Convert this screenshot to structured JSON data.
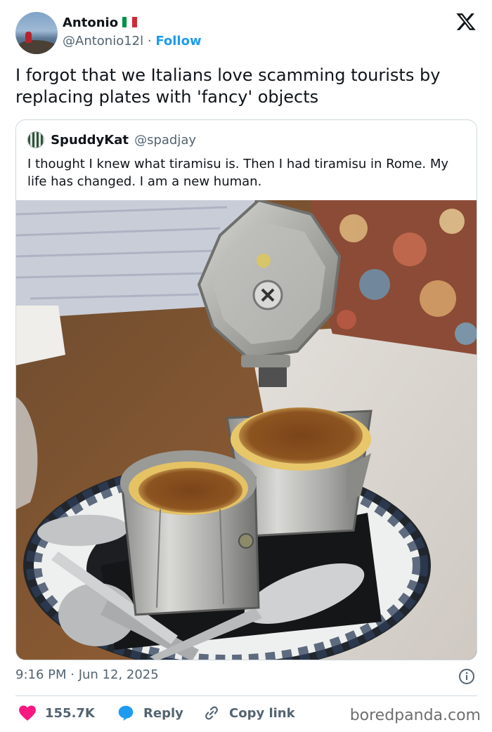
{
  "author": {
    "name": "Antonio",
    "handle": "@Antonio12l",
    "separator": "·",
    "follow_label": "Follow",
    "flag_colors": [
      "#009246",
      "#ffffff",
      "#ce2b37"
    ]
  },
  "tweet": {
    "text": "I forgot that we Italians love scamming tourists by replacing plates with 'fancy' objects",
    "timestamp": "9:16 PM · Jun 12, 2025"
  },
  "quoted": {
    "name": "SpuddyKat",
    "handle": "@spadjay",
    "text": "I thought I knew what tiramisu is. Then I had tiramisu in Rome. My life has changed. I am a new human."
  },
  "actions": {
    "like_count": "155.7K",
    "reply_label": "Reply",
    "copy_label": "Copy link"
  },
  "watermark": "boredpanda.com",
  "icons": {
    "brand": "x-logo-icon",
    "info": "info-icon",
    "like": "heart-icon",
    "reply": "reply-bubble-icon",
    "copy": "link-icon"
  },
  "colors": {
    "accent": "#1d9bf0",
    "like": "#f91880",
    "text": "#0f1419",
    "muted": "#536471",
    "border": "#cfd9de"
  }
}
